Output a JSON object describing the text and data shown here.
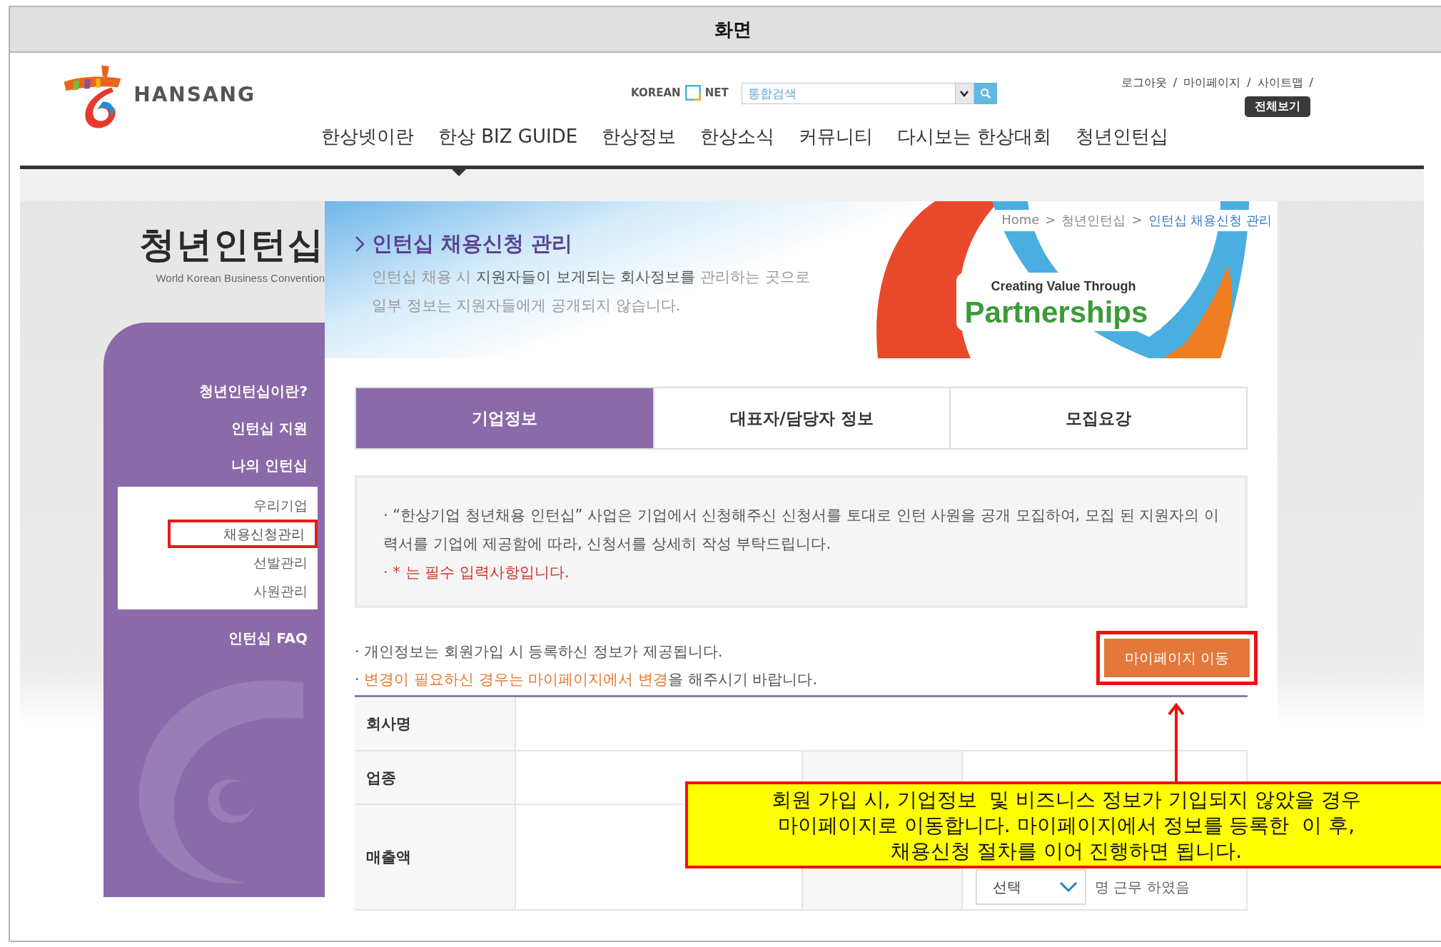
{
  "screen_label": "화면",
  "header": {
    "logo_text": "HANSANG",
    "search_brand": [
      "KOREAN",
      "NET"
    ],
    "search": {
      "placeholder": "통합검색"
    },
    "util_links": [
      "로그아웃",
      "마이페이지",
      "사이트맵"
    ],
    "util_separator": "/",
    "all_menu_button": "전체보기",
    "nav": [
      {
        "label": "한상넷이란"
      },
      {
        "label": "한상 BIZ GUIDE"
      },
      {
        "label": "한상정보"
      },
      {
        "label": "한상소식"
      },
      {
        "label": "커뮤니티"
      },
      {
        "label": "다시보는 한상대회"
      },
      {
        "label": "청년인턴십"
      }
    ]
  },
  "section": {
    "title": "청년인턴십",
    "subtitle": "World Korean Business Convention"
  },
  "sidebar": {
    "items": [
      {
        "label": "청년인턴십이란?"
      },
      {
        "label": "인턴십 지원"
      },
      {
        "label": "나의 인턴십",
        "children": [
          {
            "label": "우리기업",
            "selected": false
          },
          {
            "label": "채용신청관리",
            "selected": true
          },
          {
            "label": "선발관리",
            "selected": false
          },
          {
            "label": "사원관리",
            "selected": false
          }
        ]
      },
      {
        "label": "인턴십 FAQ"
      }
    ]
  },
  "banner": {
    "title": "인턴십 채용신청 관리",
    "description": [
      "인턴십 채용 시 **지원자들이 보게되는 회사정보를** 관리하는 곳으로",
      "일부 정보는 지원자들에게 공개되지 않습니다."
    ],
    "breadcrumb": [
      {
        "label": "Home",
        "current": false
      },
      {
        "label": "청년인턴십",
        "current": false
      },
      {
        "label": "인턴십 채용신청 관리",
        "current": true
      }
    ],
    "breadcrumb_separator": ">",
    "graphic_caption": "Creating Value Through",
    "graphic_title": "Partnerships"
  },
  "tabs": [
    {
      "label": "기업정보",
      "selected": true
    },
    {
      "label": "대표자/담당자 정보",
      "selected": false
    },
    {
      "label": "모집요강",
      "selected": false
    }
  ],
  "notice": [
    {
      "kind": "normal",
      "text": "· “한상기업 청년채용 인턴십” 사업은 기업에서 신청해주신 신청서를 토대로 인턴 사원을 공개 모집하여, 모집 된 지원자의 이력서를 기업에 제공함에 따라, 신청서를 상세히 작성 부탁드립니다."
    },
    {
      "kind": "required",
      "text": "· * 는 필수 입력사항입니다."
    }
  ],
  "notes": [
    {
      "parts": [
        {
          "text": "· 개인정보는 회원가입 시 등록하신 정보가 제공됩니다.",
          "emphasis": false
        }
      ]
    },
    {
      "parts": [
        {
          "text": "· ",
          "emphasis": false
        },
        {
          "text": "변경이 필요하신 경우는 마이페이지에서 변경",
          "emphasis": true
        },
        {
          "text": "을 해주시기 바랍니다.",
          "emphasis": false
        }
      ]
    }
  ],
  "mypage_button": {
    "label": "마이페이지 이동",
    "highlighted": true
  },
  "form_rows": [
    {
      "label": "회사명",
      "kind": "wide"
    },
    {
      "label": "업종",
      "kind": "split"
    },
    {
      "label": "매출액",
      "kind": "split",
      "select": "선택",
      "suffix": "명 근무 하였음"
    }
  ],
  "callout": {
    "text": "회원 가입 시, 기업정보  및 비즈니스 정보가 기입되지 않았을 경우\n마이페이지로 이동합니다. 마이페이지에서 정보를 등록한  이 후,\n채용신청 절차를 이어 진행하면 됩니다."
  }
}
